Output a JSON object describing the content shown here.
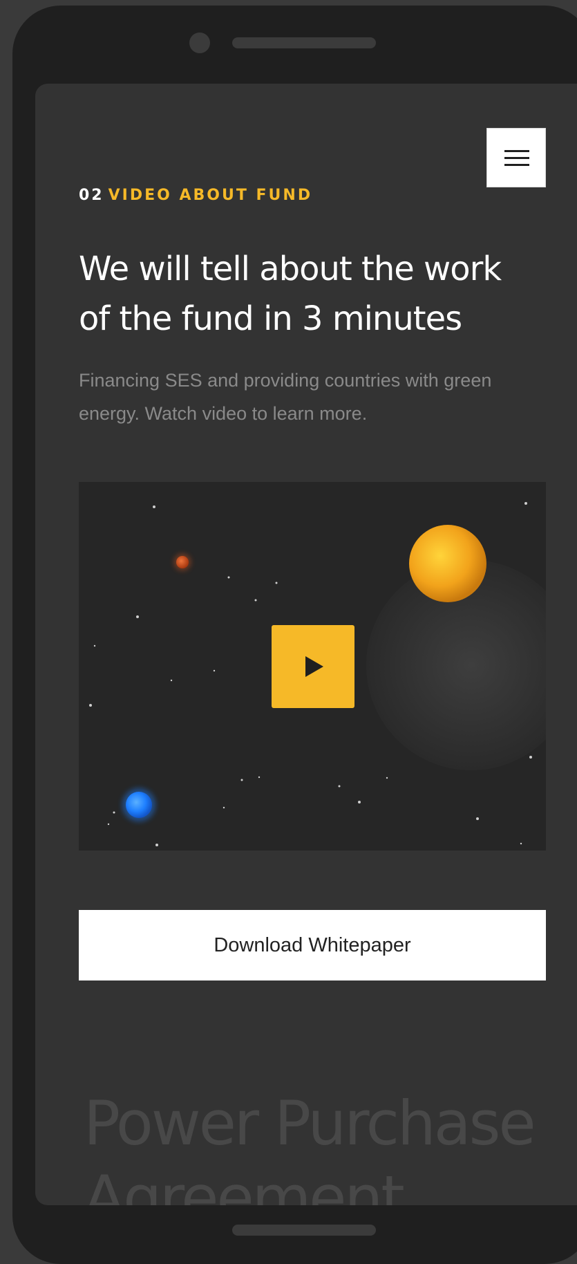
{
  "section": {
    "number": "02",
    "label": "VIDEO ABOUT FUND"
  },
  "headline": "We will tell about the work of the fund in 3 minutes",
  "description": "Financing  SES and providing countries with green energy. Watch video to learn more.",
  "video": {
    "play_icon": "play-icon"
  },
  "download_button": "Download Whitepaper",
  "next_section": {
    "title_line1": "Power Purchase",
    "title_line2": "Agreement"
  },
  "icons": {
    "menu": "hamburger-menu-icon",
    "play": "play-icon"
  },
  "colors": {
    "accent": "#f6b928",
    "background": "#333333",
    "video_background": "#262626",
    "description_text": "#8a8a8a",
    "planet_orange": "#f2a31b",
    "planet_blue": "#1e7fff",
    "planet_red": "#d9541e"
  }
}
